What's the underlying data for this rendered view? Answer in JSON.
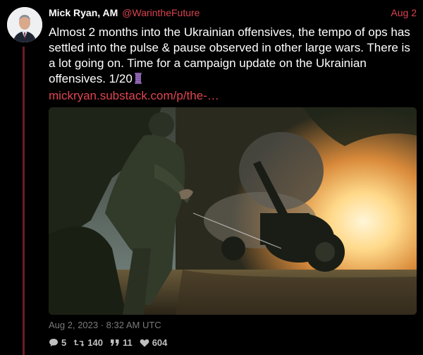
{
  "author": {
    "name": "Mick Ryan, AM",
    "handle": "@WarintheFuture",
    "date_short": "Aug 2"
  },
  "tweet": {
    "text": "Almost 2 months into the Ukrainian offensives, the tempo of ops has settled into the pulse & pause observed in other large wars. There is a lot going on. Time for a campaign update on the Ukrainian offensives. 1/20",
    "emoji_icon": "thread-spool-icon",
    "link": "mickryan.substack.com/p/the-…",
    "timestamp": "Aug 2, 2023 · 8:32 AM UTC"
  },
  "stats": {
    "replies": "5",
    "retweets": "140",
    "quotes": "11",
    "likes": "604"
  },
  "colors": {
    "background": "#000000",
    "accent": "#d9434f",
    "thread_line": "#6b1d25",
    "text": "#ffffff",
    "muted": "#7a7a7a"
  },
  "media": {
    "icon": "artillery-photo"
  }
}
